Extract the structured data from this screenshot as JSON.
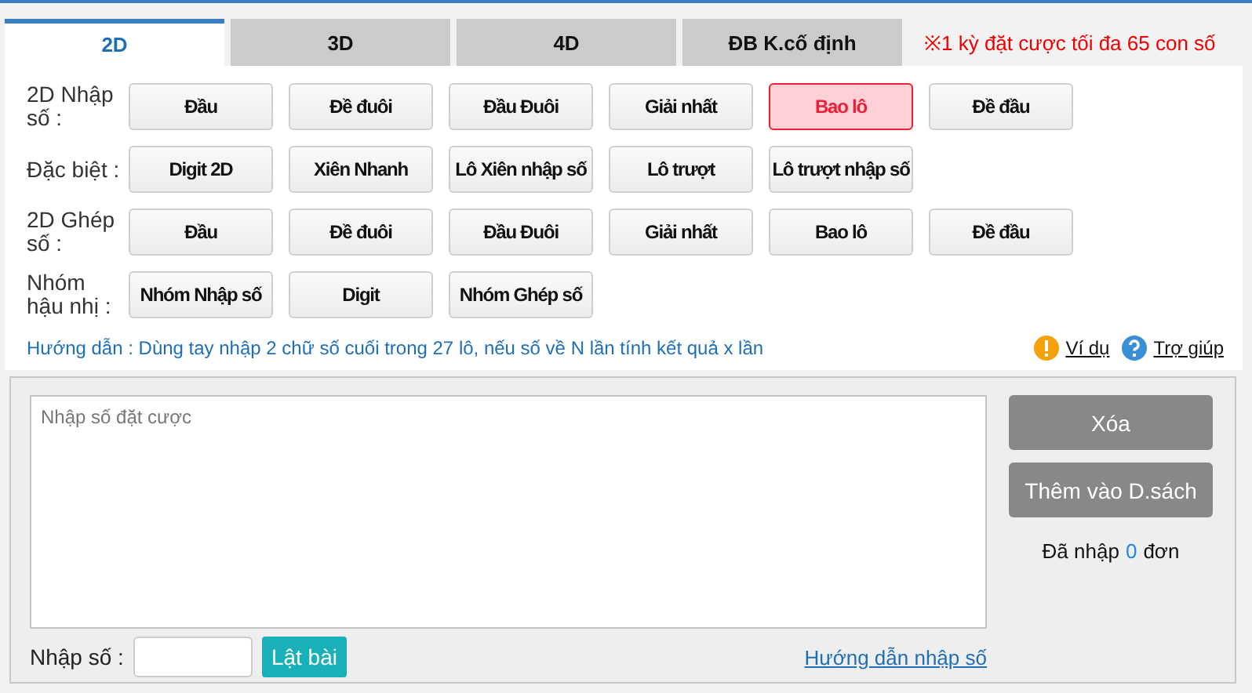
{
  "tabs": [
    {
      "label": "2D",
      "selected": true
    },
    {
      "label": "3D",
      "selected": false
    },
    {
      "label": "4D",
      "selected": false
    },
    {
      "label": "ĐB K.cố định",
      "selected": false
    }
  ],
  "notice": "※1 kỳ đặt cược tối đa 65 con số",
  "groups": [
    {
      "label": "2D Nhập số :",
      "options": [
        {
          "label": "Đầu",
          "selected": false
        },
        {
          "label": "Đề đuôi",
          "selected": false
        },
        {
          "label": "Đầu Đuôi",
          "selected": false
        },
        {
          "label": "Giải nhất",
          "selected": false
        },
        {
          "label": "Bao lô",
          "selected": true
        },
        {
          "label": "Đề đầu",
          "selected": false
        }
      ]
    },
    {
      "label": "Đặc biệt :",
      "options": [
        {
          "label": "Digit 2D",
          "selected": false
        },
        {
          "label": "Xiên Nhanh",
          "selected": false
        },
        {
          "label": "Lô Xiên nhập số",
          "selected": false
        },
        {
          "label": "Lô trượt",
          "selected": false
        },
        {
          "label": "Lô trượt nhập số",
          "selected": false
        }
      ]
    },
    {
      "label": "2D Ghép số :",
      "options": [
        {
          "label": "Đầu",
          "selected": false
        },
        {
          "label": "Đề đuôi",
          "selected": false
        },
        {
          "label": "Đầu Đuôi",
          "selected": false
        },
        {
          "label": "Giải nhất",
          "selected": false
        },
        {
          "label": "Bao lô",
          "selected": false
        },
        {
          "label": "Đề đầu",
          "selected": false
        }
      ]
    },
    {
      "label": "Nhóm hậu nhị :",
      "options": [
        {
          "label": "Nhóm Nhập số",
          "selected": false
        },
        {
          "label": "Digit",
          "selected": false
        },
        {
          "label": "Nhóm Ghép số",
          "selected": false
        }
      ]
    }
  ],
  "guide": "Hướng dẫn : Dùng tay nhập 2 chữ số cuối trong 27 lô, nếu số về N lần tính kết quả x lần",
  "example_link": "Ví dụ",
  "help_link": "Trợ giúp",
  "bet_input": {
    "placeholder": "Nhập số đặt cược"
  },
  "clear_button": "Xóa",
  "add_button": "Thêm vào D.sách",
  "count": {
    "prefix": "Đã nhập",
    "value": "0",
    "suffix": "đơn"
  },
  "number_label": "Nhập số :",
  "flip_button": "Lật bài",
  "input_guide_link": "Hướng dẫn nhập số"
}
